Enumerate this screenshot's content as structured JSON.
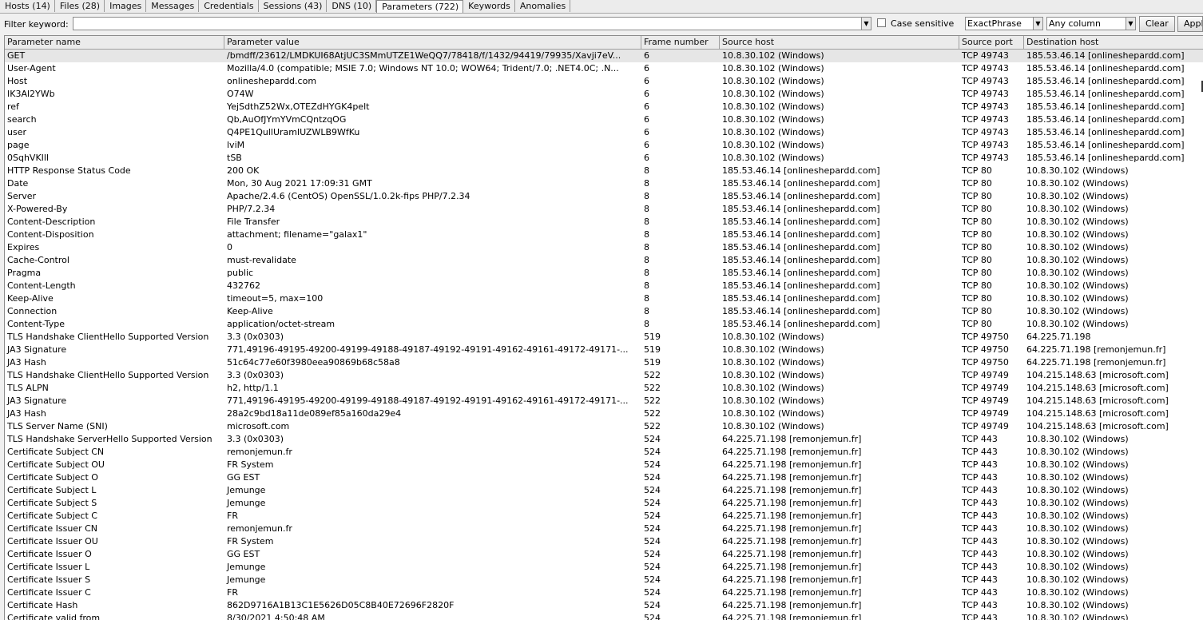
{
  "tabs": [
    {
      "label": "Hosts (14)",
      "active": false
    },
    {
      "label": "Files (28)",
      "active": false
    },
    {
      "label": "Images",
      "active": false
    },
    {
      "label": "Messages",
      "active": false
    },
    {
      "label": "Credentials",
      "active": false
    },
    {
      "label": "Sessions (43)",
      "active": false
    },
    {
      "label": "DNS (10)",
      "active": false
    },
    {
      "label": "Parameters (722)",
      "active": true
    },
    {
      "label": "Keywords",
      "active": false
    },
    {
      "label": "Anomalies",
      "active": false
    }
  ],
  "filter": {
    "label": "Filter keyword:",
    "value": "",
    "case_sensitive_label": "Case sensitive",
    "case_sensitive_checked": false,
    "match_mode": "ExactPhrase",
    "column_scope": "Any column",
    "clear_label": "Clear",
    "apply_label": "Apply"
  },
  "table": {
    "columns": [
      "Parameter name",
      "Parameter value",
      "Frame number",
      "Source host",
      "Source port",
      "Destination host"
    ],
    "selected_row": 0,
    "rows": [
      [
        "GET",
        "/bmdff/23612/LMDKUI68AtjUC3SMmUTZE1WeQQ7/78418/f/1432/94419/79935/Xavji7eV...",
        "6",
        "10.8.30.102 (Windows)",
        "TCP 49743",
        "185.53.46.14 [onlineshepardd.com]"
      ],
      [
        "User-Agent",
        "Mozilla/4.0 (compatible; MSIE 7.0; Windows NT 10.0; WOW64; Trident/7.0; .NET4.0C; .N...",
        "6",
        "10.8.30.102 (Windows)",
        "TCP 49743",
        "185.53.46.14 [onlineshepardd.com]"
      ],
      [
        "Host",
        "onlineshepardd.com",
        "6",
        "10.8.30.102 (Windows)",
        "TCP 49743",
        "185.53.46.14 [onlineshepardd.com]"
      ],
      [
        "IK3Al2YWb",
        "O74W",
        "6",
        "10.8.30.102 (Windows)",
        "TCP 49743",
        "185.53.46.14 [onlineshepardd.com]"
      ],
      [
        "ref",
        "YejSdthZ52Wx,OTEZdHYGK4pelt",
        "6",
        "10.8.30.102 (Windows)",
        "TCP 49743",
        "185.53.46.14 [onlineshepardd.com]"
      ],
      [
        "search",
        "Qb,AuOfJYmYVmCQntzqOG",
        "6",
        "10.8.30.102 (Windows)",
        "TCP 49743",
        "185.53.46.14 [onlineshepardd.com]"
      ],
      [
        "user",
        "Q4PE1QullUramlUZWLB9WfKu",
        "6",
        "10.8.30.102 (Windows)",
        "TCP 49743",
        "185.53.46.14 [onlineshepardd.com]"
      ],
      [
        "page",
        "lviM",
        "6",
        "10.8.30.102 (Windows)",
        "TCP 49743",
        "185.53.46.14 [onlineshepardd.com]"
      ],
      [
        "0SqhVKIll",
        "tSB",
        "6",
        "10.8.30.102 (Windows)",
        "TCP 49743",
        "185.53.46.14 [onlineshepardd.com]"
      ],
      [
        "HTTP Response Status Code",
        "200 OK",
        "8",
        "185.53.46.14 [onlineshepardd.com]",
        "TCP 80",
        "10.8.30.102 (Windows)"
      ],
      [
        "Date",
        "Mon, 30 Aug 2021 17:09:31 GMT",
        "8",
        "185.53.46.14 [onlineshepardd.com]",
        "TCP 80",
        "10.8.30.102 (Windows)"
      ],
      [
        "Server",
        "Apache/2.4.6 (CentOS) OpenSSL/1.0.2k-fips PHP/7.2.34",
        "8",
        "185.53.46.14 [onlineshepardd.com]",
        "TCP 80",
        "10.8.30.102 (Windows)"
      ],
      [
        "X-Powered-By",
        "PHP/7.2.34",
        "8",
        "185.53.46.14 [onlineshepardd.com]",
        "TCP 80",
        "10.8.30.102 (Windows)"
      ],
      [
        "Content-Description",
        "File Transfer",
        "8",
        "185.53.46.14 [onlineshepardd.com]",
        "TCP 80",
        "10.8.30.102 (Windows)"
      ],
      [
        "Content-Disposition",
        "attachment; filename=\"galax1\"",
        "8",
        "185.53.46.14 [onlineshepardd.com]",
        "TCP 80",
        "10.8.30.102 (Windows)"
      ],
      [
        "Expires",
        "0",
        "8",
        "185.53.46.14 [onlineshepardd.com]",
        "TCP 80",
        "10.8.30.102 (Windows)"
      ],
      [
        "Cache-Control",
        "must-revalidate",
        "8",
        "185.53.46.14 [onlineshepardd.com]",
        "TCP 80",
        "10.8.30.102 (Windows)"
      ],
      [
        "Pragma",
        "public",
        "8",
        "185.53.46.14 [onlineshepardd.com]",
        "TCP 80",
        "10.8.30.102 (Windows)"
      ],
      [
        "Content-Length",
        "432762",
        "8",
        "185.53.46.14 [onlineshepardd.com]",
        "TCP 80",
        "10.8.30.102 (Windows)"
      ],
      [
        "Keep-Alive",
        "timeout=5, max=100",
        "8",
        "185.53.46.14 [onlineshepardd.com]",
        "TCP 80",
        "10.8.30.102 (Windows)"
      ],
      [
        "Connection",
        "Keep-Alive",
        "8",
        "185.53.46.14 [onlineshepardd.com]",
        "TCP 80",
        "10.8.30.102 (Windows)"
      ],
      [
        "Content-Type",
        "application/octet-stream",
        "8",
        "185.53.46.14 [onlineshepardd.com]",
        "TCP 80",
        "10.8.30.102 (Windows)"
      ],
      [
        "TLS Handshake ClientHello Supported Version",
        "3.3 (0x0303)",
        "519",
        "10.8.30.102 (Windows)",
        "TCP 49750",
        "64.225.71.198"
      ],
      [
        "JA3 Signature",
        "771,49196-49195-49200-49199-49188-49187-49192-49191-49162-49161-49172-49171-...",
        "519",
        "10.8.30.102 (Windows)",
        "TCP 49750",
        "64.225.71.198 [remonjemun.fr]"
      ],
      [
        "JA3 Hash",
        "51c64c77e60f3980eea90869b68c58a8",
        "519",
        "10.8.30.102 (Windows)",
        "TCP 49750",
        "64.225.71.198 [remonjemun.fr]"
      ],
      [
        "TLS Handshake ClientHello Supported Version",
        "3.3 (0x0303)",
        "522",
        "10.8.30.102 (Windows)",
        "TCP 49749",
        "104.215.148.63 [microsoft.com]"
      ],
      [
        "TLS ALPN",
        "h2, http/1.1",
        "522",
        "10.8.30.102 (Windows)",
        "TCP 49749",
        "104.215.148.63 [microsoft.com]"
      ],
      [
        "JA3 Signature",
        "771,49196-49195-49200-49199-49188-49187-49192-49191-49162-49161-49172-49171-...",
        "522",
        "10.8.30.102 (Windows)",
        "TCP 49749",
        "104.215.148.63 [microsoft.com]"
      ],
      [
        "JA3 Hash",
        "28a2c9bd18a11de089ef85a160da29e4",
        "522",
        "10.8.30.102 (Windows)",
        "TCP 49749",
        "104.215.148.63 [microsoft.com]"
      ],
      [
        "TLS Server Name (SNI)",
        "microsoft.com",
        "522",
        "10.8.30.102 (Windows)",
        "TCP 49749",
        "104.215.148.63 [microsoft.com]"
      ],
      [
        "TLS Handshake ServerHello Supported Version",
        "3.3 (0x0303)",
        "524",
        "64.225.71.198 [remonjemun.fr]",
        "TCP 443",
        "10.8.30.102 (Windows)"
      ],
      [
        "Certificate Subject CN",
        "remonjemun.fr",
        "524",
        "64.225.71.198 [remonjemun.fr]",
        "TCP 443",
        "10.8.30.102 (Windows)"
      ],
      [
        "Certificate Subject OU",
        "FR System",
        "524",
        "64.225.71.198 [remonjemun.fr]",
        "TCP 443",
        "10.8.30.102 (Windows)"
      ],
      [
        "Certificate Subject O",
        "GG EST",
        "524",
        "64.225.71.198 [remonjemun.fr]",
        "TCP 443",
        "10.8.30.102 (Windows)"
      ],
      [
        "Certificate Subject L",
        "Jemunge",
        "524",
        "64.225.71.198 [remonjemun.fr]",
        "TCP 443",
        "10.8.30.102 (Windows)"
      ],
      [
        "Certificate Subject S",
        "Jemunge",
        "524",
        "64.225.71.198 [remonjemun.fr]",
        "TCP 443",
        "10.8.30.102 (Windows)"
      ],
      [
        "Certificate Subject C",
        "FR",
        "524",
        "64.225.71.198 [remonjemun.fr]",
        "TCP 443",
        "10.8.30.102 (Windows)"
      ],
      [
        "Certificate Issuer CN",
        "remonjemun.fr",
        "524",
        "64.225.71.198 [remonjemun.fr]",
        "TCP 443",
        "10.8.30.102 (Windows)"
      ],
      [
        "Certificate Issuer OU",
        "FR System",
        "524",
        "64.225.71.198 [remonjemun.fr]",
        "TCP 443",
        "10.8.30.102 (Windows)"
      ],
      [
        "Certificate Issuer O",
        "GG EST",
        "524",
        "64.225.71.198 [remonjemun.fr]",
        "TCP 443",
        "10.8.30.102 (Windows)"
      ],
      [
        "Certificate Issuer L",
        "Jemunge",
        "524",
        "64.225.71.198 [remonjemun.fr]",
        "TCP 443",
        "10.8.30.102 (Windows)"
      ],
      [
        "Certificate Issuer S",
        "Jemunge",
        "524",
        "64.225.71.198 [remonjemun.fr]",
        "TCP 443",
        "10.8.30.102 (Windows)"
      ],
      [
        "Certificate Issuer C",
        "FR",
        "524",
        "64.225.71.198 [remonjemun.fr]",
        "TCP 443",
        "10.8.30.102 (Windows)"
      ],
      [
        "Certificate Hash",
        "862D9716A1B13C1E5626D05C8B40E72696F2820F",
        "524",
        "64.225.71.198 [remonjemun.fr]",
        "TCP 443",
        "10.8.30.102 (Windows)"
      ],
      [
        "Certificate valid from",
        "8/30/2021 4:50:48 AM",
        "524",
        "64.225.71.198 [remonjemun.fr]",
        "TCP 443",
        "10.8.30.102 (Windows)"
      ]
    ]
  }
}
